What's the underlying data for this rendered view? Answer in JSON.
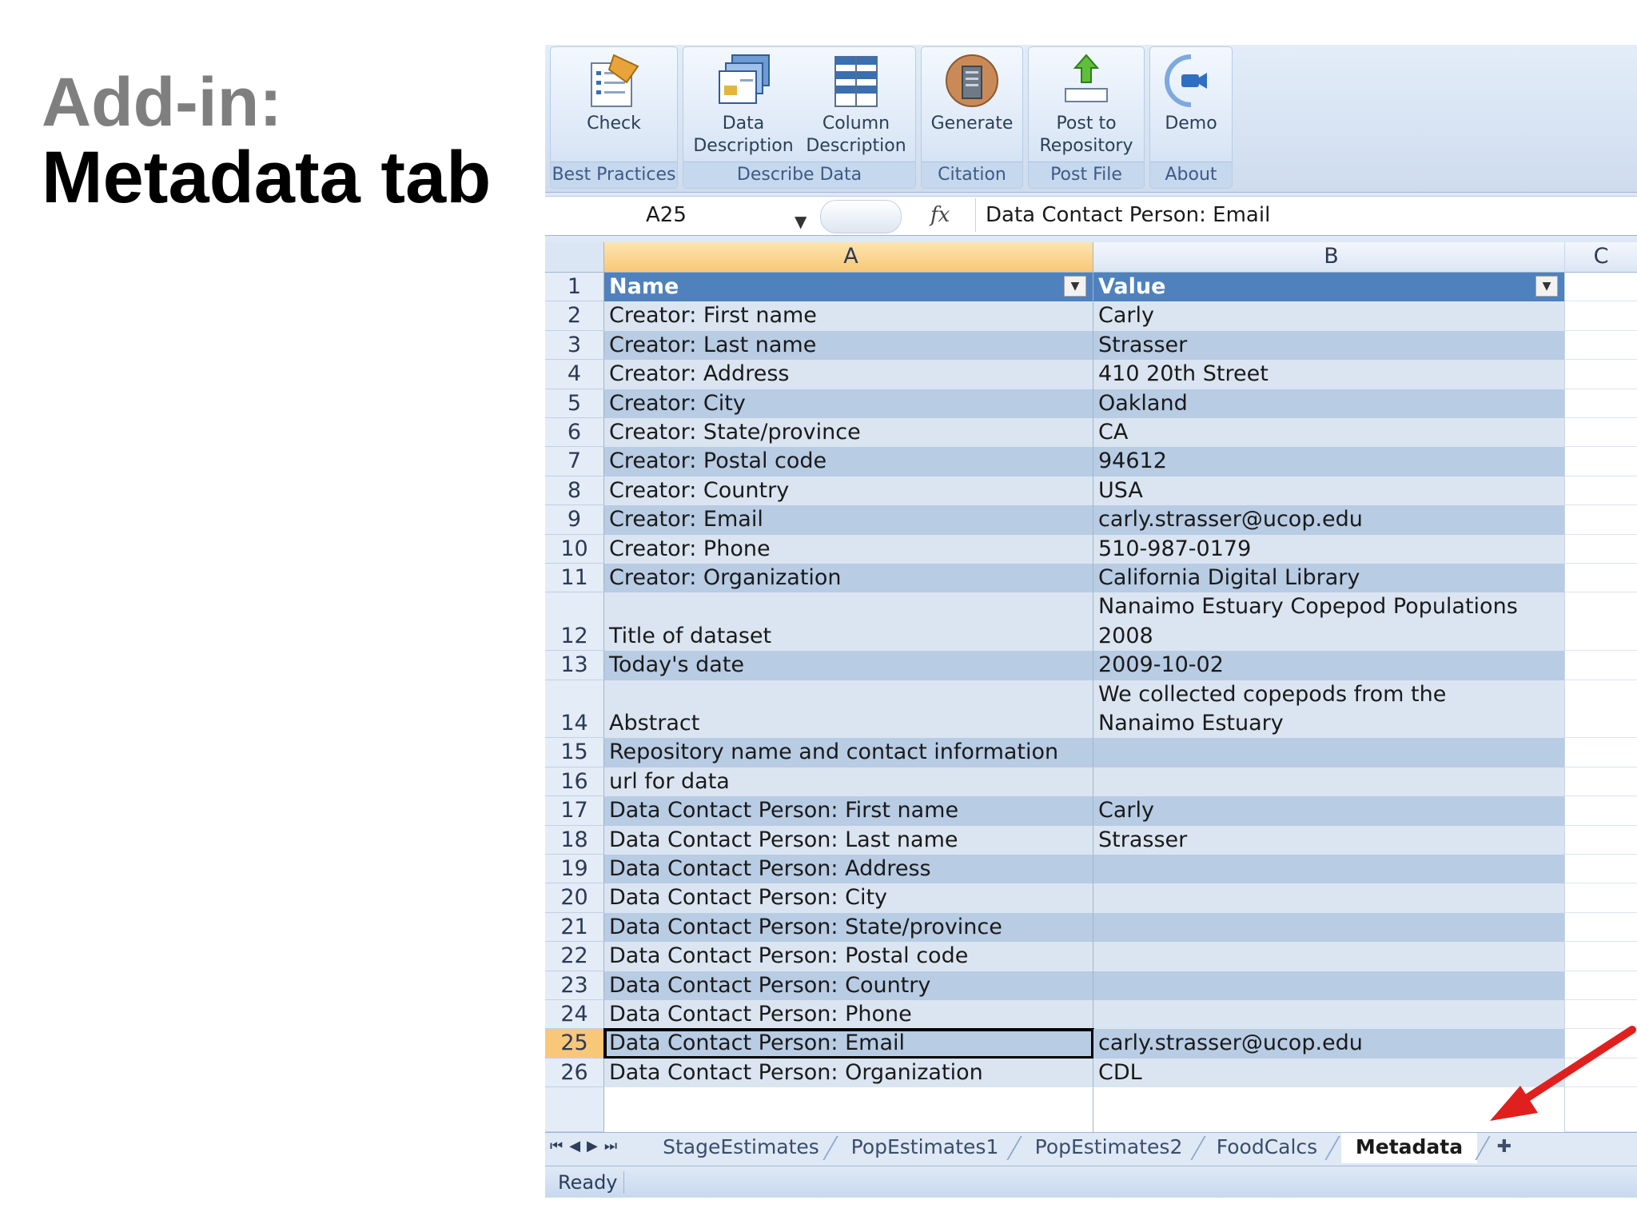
{
  "slide": {
    "title_line1": "Add-in:",
    "title_line2": "Metadata tab"
  },
  "ribbon": {
    "groups": [
      {
        "label": "Best Practices",
        "buttons": [
          {
            "label_lines": [
              "Check"
            ],
            "icon": "checklist-icon"
          }
        ]
      },
      {
        "label": "Describe Data",
        "buttons": [
          {
            "label_lines": [
              "Data",
              "Description"
            ],
            "icon": "data-description-icon"
          },
          {
            "label_lines": [
              "Column",
              "Description"
            ],
            "icon": "column-description-icon"
          }
        ]
      },
      {
        "label": "Citation",
        "buttons": [
          {
            "label_lines": [
              "Generate"
            ],
            "icon": "generate-citation-icon"
          }
        ]
      },
      {
        "label": "Post File",
        "buttons": [
          {
            "label_lines": [
              "Post to",
              "Repository"
            ],
            "icon": "upload-icon"
          }
        ]
      },
      {
        "label": "About",
        "buttons": [
          {
            "label_lines": [
              "Demo"
            ],
            "icon": "video-camera-icon"
          }
        ]
      }
    ]
  },
  "formula_bar": {
    "name_box": "A25",
    "fx_label": "fx",
    "formula": "Data Contact Person: Email"
  },
  "columns": [
    "A",
    "B",
    "C"
  ],
  "table": {
    "header": {
      "row": "1",
      "a": "Name",
      "b": "Value"
    },
    "rows": [
      {
        "row": "2",
        "a": "Creator: First name",
        "b": "Carly"
      },
      {
        "row": "3",
        "a": "Creator: Last name",
        "b": "Strasser"
      },
      {
        "row": "4",
        "a": "Creator: Address",
        "b": "410 20th Street"
      },
      {
        "row": "5",
        "a": "Creator: City",
        "b": "Oakland"
      },
      {
        "row": "6",
        "a": "Creator: State/province",
        "b": "CA"
      },
      {
        "row": "7",
        "a": "Creator: Postal code",
        "b": "94612"
      },
      {
        "row": "8",
        "a": "Creator: Country",
        "b": "USA"
      },
      {
        "row": "9",
        "a": "Creator: Email",
        "b": "carly.strasser@ucop.edu"
      },
      {
        "row": "10",
        "a": "Creator: Phone",
        "b": "510-987-0179"
      },
      {
        "row": "11",
        "a": "Creator: Organization",
        "b": "California Digital Library"
      },
      {
        "row": "12",
        "a": "Title of dataset",
        "b": "Nanaimo Estuary Copepod Populations 2008",
        "b_lines": [
          "Nanaimo Estuary Copepod Populations",
          "2008"
        ]
      },
      {
        "row": "13",
        "a": "Today's date",
        "b": "2009-10-02"
      },
      {
        "row": "14",
        "a": "Abstract",
        "b": "We collected copepods from the Nanaimo Estuary",
        "b_lines": [
          "We collected copepods from the",
          "Nanaimo Estuary"
        ]
      },
      {
        "row": "15",
        "a": "Repository name and contact information",
        "b": ""
      },
      {
        "row": "16",
        "a": "url for data",
        "b": ""
      },
      {
        "row": "17",
        "a": "Data Contact Person: First name",
        "b": "Carly"
      },
      {
        "row": "18",
        "a": "Data Contact Person: Last name",
        "b": "Strasser"
      },
      {
        "row": "19",
        "a": "Data Contact Person: Address",
        "b": ""
      },
      {
        "row": "20",
        "a": "Data Contact Person: City",
        "b": ""
      },
      {
        "row": "21",
        "a": "Data Contact Person: State/province",
        "b": ""
      },
      {
        "row": "22",
        "a": "Data Contact Person: Postal code",
        "b": ""
      },
      {
        "row": "23",
        "a": "Data Contact Person: Country",
        "b": ""
      },
      {
        "row": "24",
        "a": "Data Contact Person: Phone",
        "b": ""
      },
      {
        "row": "25",
        "a": "Data Contact Person: Email",
        "b": "carly.strasser@ucop.edu",
        "active": true
      },
      {
        "row": "26",
        "a": "Data Contact Person: Organization",
        "b": "CDL"
      }
    ]
  },
  "sheet_tabs": [
    "StageEstimates",
    "PopEstimates1",
    "PopEstimates2",
    "FoodCalcs",
    "Metadata"
  ],
  "active_sheet": "Metadata",
  "status": "Ready",
  "colors": {
    "table_header": "#4f81bd",
    "band_light": "#dbe5f1",
    "band_dark": "#b8cce4",
    "arrow": "#e0201e",
    "title_gray": "#7f7f7f"
  }
}
